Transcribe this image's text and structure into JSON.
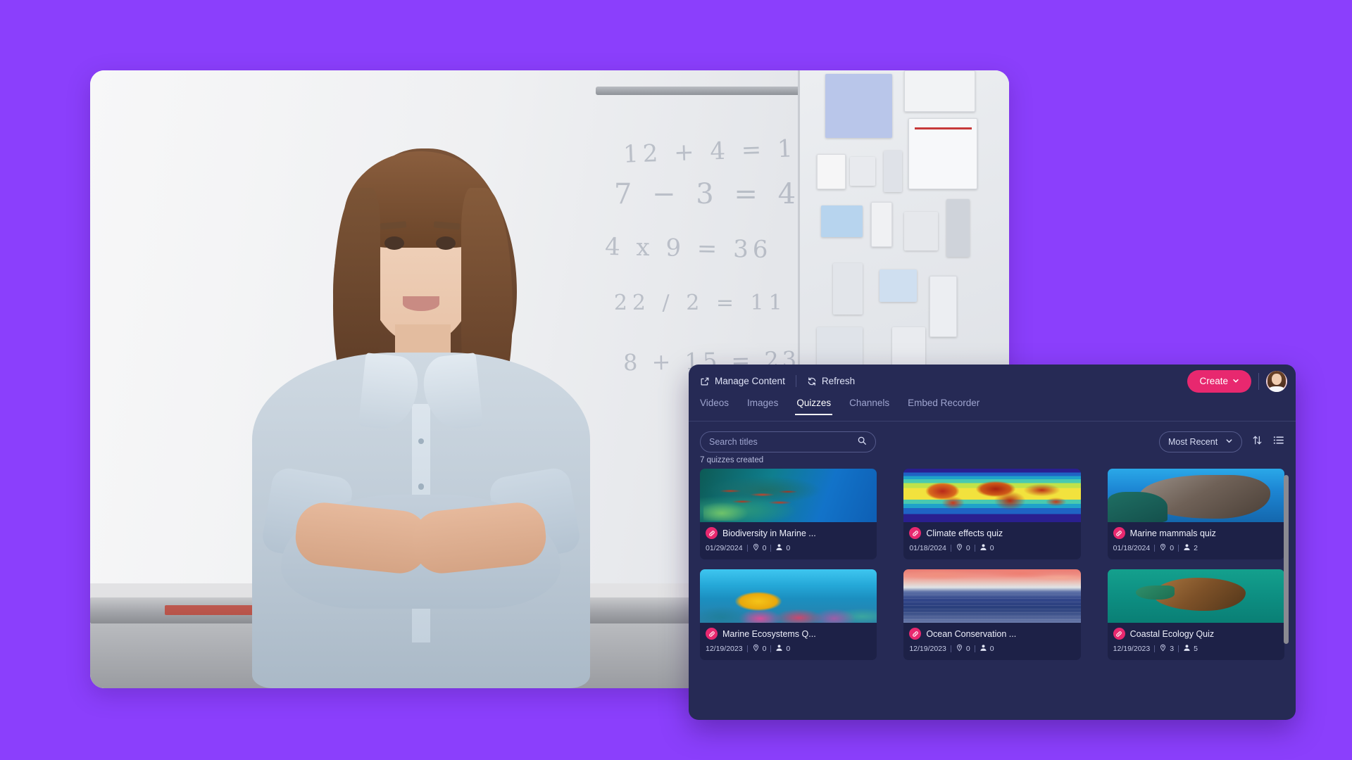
{
  "background": {
    "color": "#8B3FFC"
  },
  "photo": {
    "alt": "Teacher standing with arms crossed in front of a classroom whiteboard"
  },
  "panel": {
    "accent_pink": "#e8286f",
    "surface": "#262a55",
    "card_surface": "#1d2147",
    "toolbar": {
      "manage_content": "Manage Content",
      "refresh": "Refresh",
      "create": "Create"
    },
    "tabs": [
      {
        "label": "Videos",
        "active": false
      },
      {
        "label": "Images",
        "active": false
      },
      {
        "label": "Quizzes",
        "active": true
      },
      {
        "label": "Channels",
        "active": false
      },
      {
        "label": "Embed Recorder",
        "active": false
      }
    ],
    "filters": {
      "search_placeholder": "Search titles",
      "search_value": "",
      "sort_selected": "Most Recent",
      "sort_options": [
        "Most Recent"
      ]
    },
    "count_label": "7 quizzes created",
    "cards": [
      {
        "title": "Biodiversity in Marine ...",
        "date": "01/29/2024",
        "questions": "0",
        "participants": "0",
        "thumb": "t-reeffish"
      },
      {
        "title": "Climate effects quiz",
        "date": "01/18/2024",
        "questions": "0",
        "participants": "0",
        "thumb": "t-climate"
      },
      {
        "title": "Marine mammals quiz",
        "date": "01/18/2024",
        "questions": "0",
        "participants": "2",
        "thumb": "t-seal"
      },
      {
        "title": "Marine Ecosystems Q...",
        "date": "12/19/2023",
        "questions": "0",
        "participants": "0",
        "thumb": "t-coral"
      },
      {
        "title": "Ocean Conservation ...",
        "date": "12/19/2023",
        "questions": "0",
        "participants": "0",
        "thumb": "t-sunset"
      },
      {
        "title": "Coastal Ecology Quiz",
        "date": "12/19/2023",
        "questions": "3",
        "participants": "5",
        "thumb": "t-turtle"
      }
    ]
  },
  "icons": {
    "manage": "external-link-icon",
    "refresh": "refresh-icon",
    "search": "search-icon",
    "chevron": "chevron-down-icon",
    "sort": "sort-arrows-icon",
    "list": "list-view-icon",
    "link": "link-icon",
    "question": "question-marker-icon",
    "person": "person-icon"
  }
}
